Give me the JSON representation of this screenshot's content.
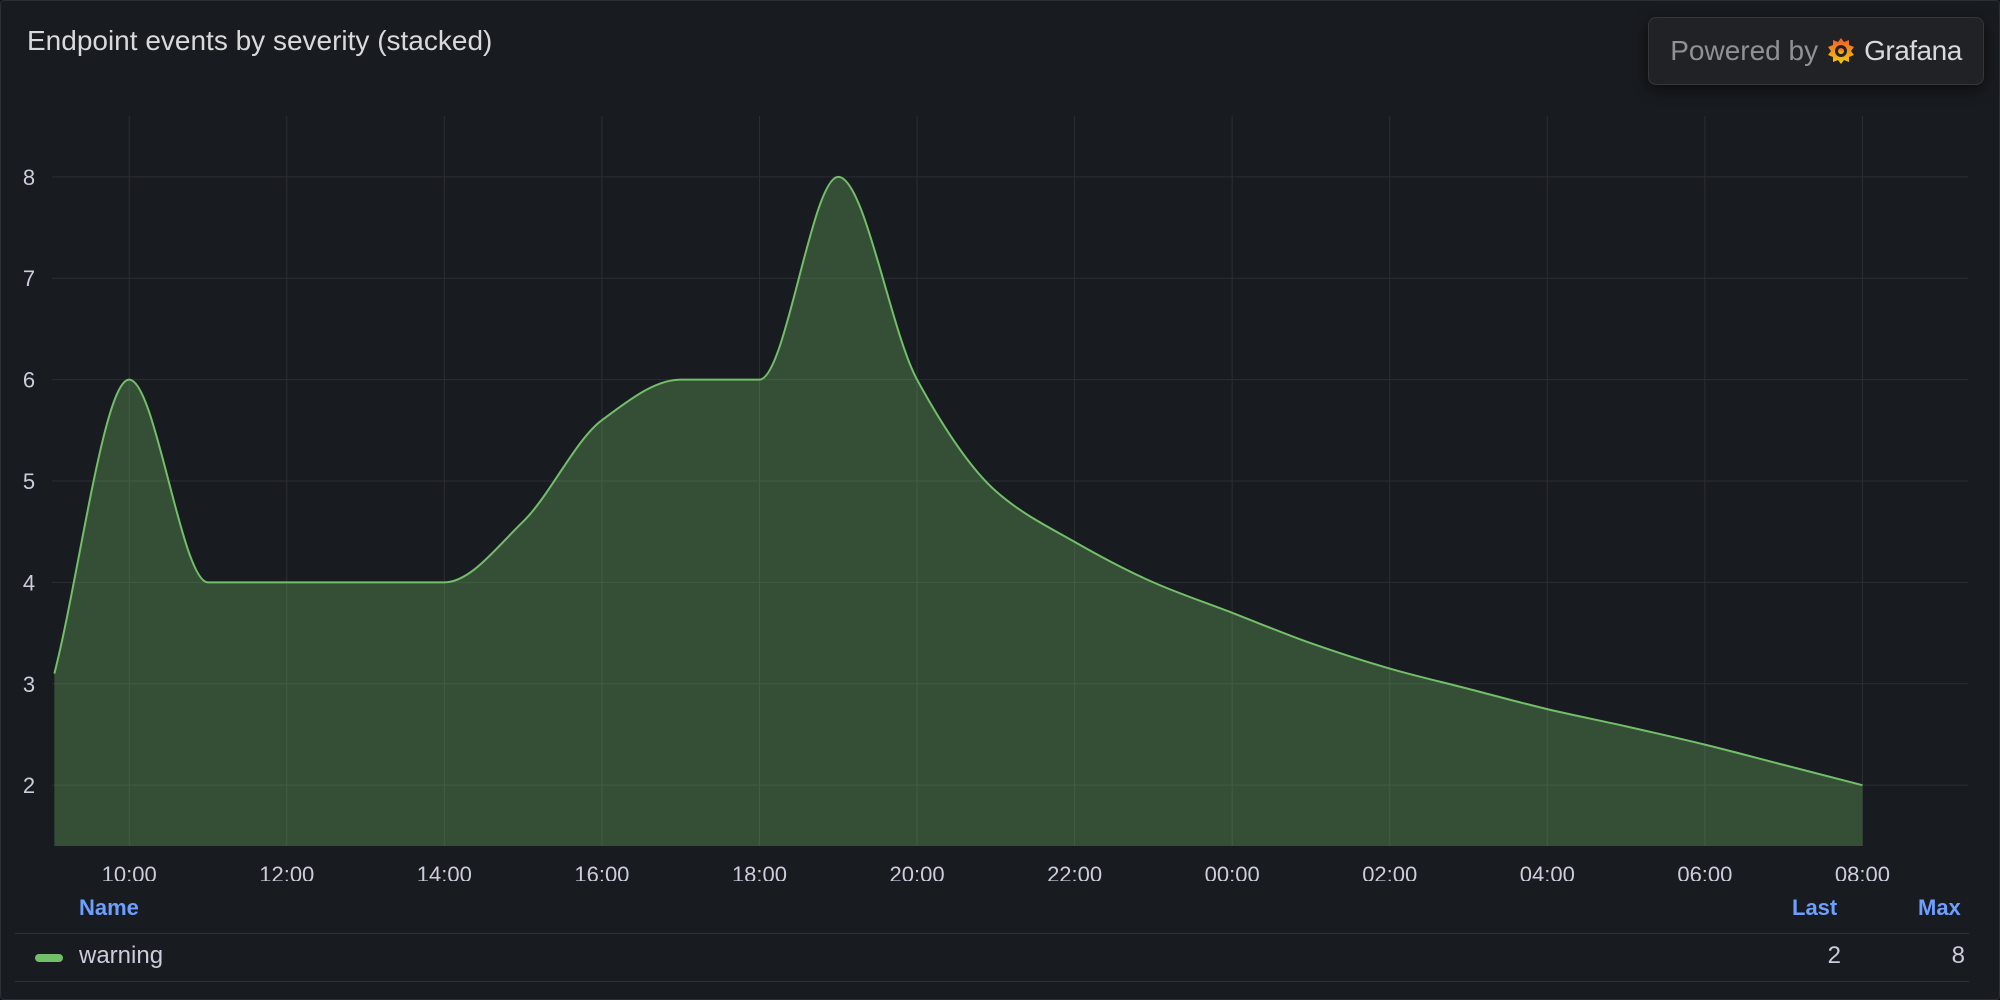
{
  "panel": {
    "title": "Endpoint events by severity (stacked)",
    "powered_by": "Powered by",
    "brand": "Grafana"
  },
  "legend": {
    "headers": {
      "name": "Name",
      "last": "Last",
      "max": "Max"
    },
    "rows": [
      {
        "name": "warning",
        "last": "2",
        "max": "8",
        "color": "#73bf69"
      }
    ]
  },
  "chart_data": {
    "type": "area",
    "title": "Endpoint events by severity (stacked)",
    "xlabel": "",
    "ylabel": "",
    "x_ticks": [
      "10:00",
      "12:00",
      "14:00",
      "16:00",
      "18:00",
      "20:00",
      "22:00",
      "00:00",
      "02:00",
      "04:00",
      "06:00",
      "08:00"
    ],
    "y_ticks": [
      2,
      3,
      4,
      5,
      6,
      7,
      8
    ],
    "ylim": [
      1.4,
      8.6
    ],
    "grid": true,
    "legend_position": "bottom",
    "x_unit": "hours since 10:00",
    "xlim": [
      -0.98,
      23.34
    ],
    "series": [
      {
        "name": "warning",
        "color": "#73bf69",
        "x": [
          -0.95,
          0,
          1,
          2,
          3,
          4,
          5,
          6,
          7,
          8,
          9,
          10,
          11,
          12,
          13,
          14,
          15,
          16,
          17,
          18,
          19,
          20,
          21,
          22
        ],
        "y": [
          3.1,
          6,
          4,
          4,
          4,
          4,
          4.6,
          5.6,
          6,
          6,
          8,
          6,
          4.9,
          4.4,
          4.0,
          3.7,
          3.4,
          3.15,
          2.95,
          2.75,
          2.58,
          2.4,
          2.2,
          2
        ]
      }
    ]
  }
}
